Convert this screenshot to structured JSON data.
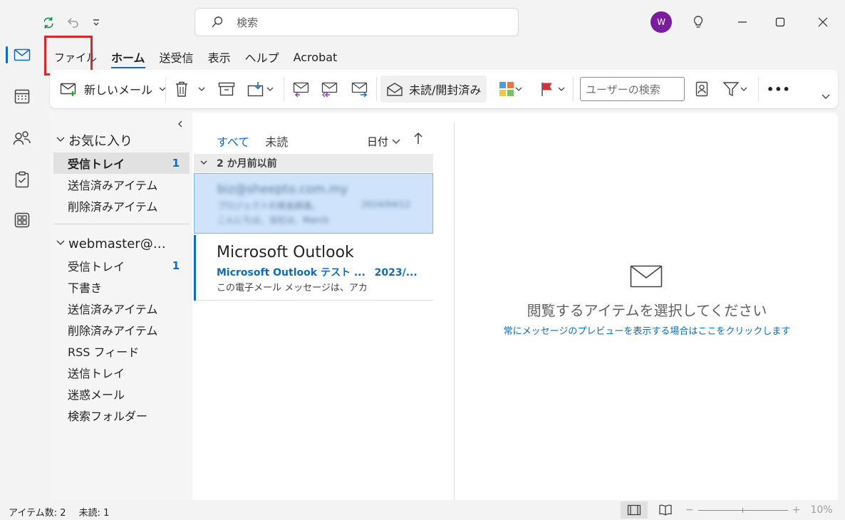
{
  "titlebar": {
    "search_placeholder": "検索",
    "avatar_initial": "W"
  },
  "menu": {
    "file": "ファイル",
    "home": "ホーム",
    "send_receive": "送受信",
    "view": "表示",
    "help": "ヘルプ",
    "acrobat": "Acrobat"
  },
  "ribbon": {
    "new_mail": "新しいメール",
    "read_unread": "未読/開封済み",
    "user_search_placeholder": "ユーザーの検索",
    "more": "•••"
  },
  "folders": {
    "favorites": "お気に入り",
    "favorites_items": [
      {
        "label": "受信トレイ",
        "count": "1"
      },
      {
        "label": "送信済みアイテム",
        "count": ""
      },
      {
        "label": "削除済みアイテム",
        "count": ""
      }
    ],
    "account": "webmaster@…",
    "account_items": [
      {
        "label": "受信トレイ",
        "count": "1"
      },
      {
        "label": "下書き",
        "count": ""
      },
      {
        "label": "送信済みアイテム",
        "count": ""
      },
      {
        "label": "削除済みアイテム",
        "count": ""
      },
      {
        "label": "RSS フィード",
        "count": ""
      },
      {
        "label": "送信トレイ",
        "count": ""
      },
      {
        "label": "迷惑メール",
        "count": ""
      },
      {
        "label": "検索フォルダー",
        "count": ""
      }
    ]
  },
  "message_list": {
    "tab_all": "すべて",
    "tab_unread": "未読",
    "sort_label": "日付",
    "group_header": "2 か月前以前",
    "messages": [
      {
        "sender": "biz@sheepto.com.my",
        "subject": "プロジェクトの資金調達。",
        "date": "2024/04/12",
        "preview": "こんにちは、当社は、Marcb"
      },
      {
        "sender": "Microsoft Outlook",
        "subject": "Microsoft Outlook テスト ...",
        "date": "2023/...",
        "preview": "この電子メール メッセージは、アカ"
      }
    ]
  },
  "reading_pane": {
    "title": "閲覧するアイテムを選択してください",
    "link": "常にメッセージのプレビューを表示する場合はここをクリックします"
  },
  "status_bar": {
    "items_count": "アイテム数: 2",
    "unread_count": "未読: 1",
    "zoom_minus": "−",
    "zoom_plus": "+",
    "zoom_level": "10%"
  },
  "colors": {
    "accent": "#0f6cbd",
    "highlight_box": "#d62828",
    "avatar_bg": "#7a1d9c",
    "selected_message_bg": "#cfe4fa"
  }
}
